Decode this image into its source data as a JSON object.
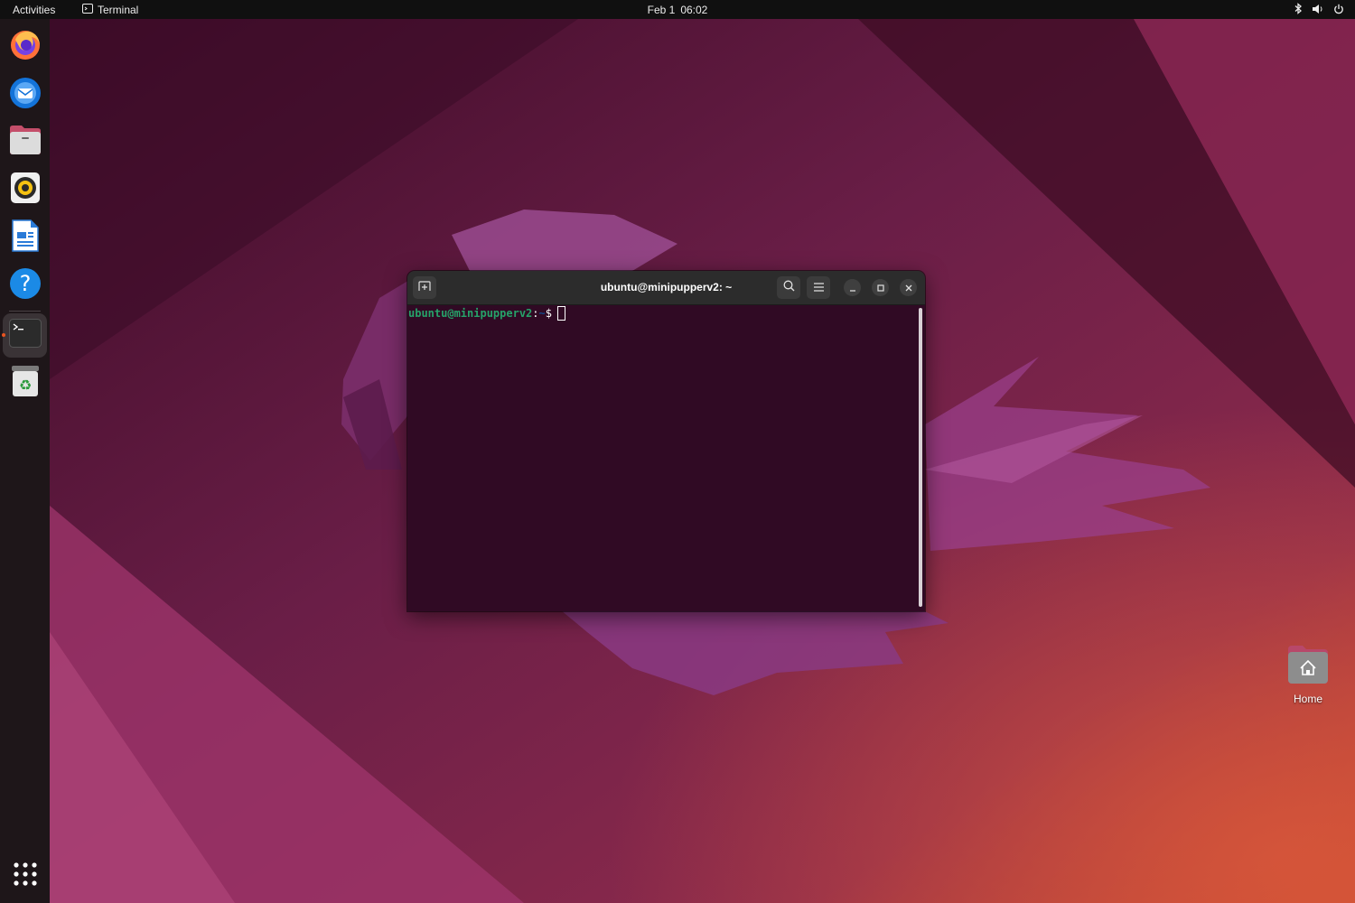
{
  "topbar": {
    "activities": "Activities",
    "app_name": "Terminal",
    "date": "Feb 1",
    "time": "06:02",
    "tray_icons": [
      "bluetooth-icon",
      "volume-icon",
      "power-icon"
    ]
  },
  "dock": {
    "items": [
      {
        "name": "Firefox",
        "icon": "firefox-icon"
      },
      {
        "name": "Thunderbird Mail",
        "icon": "thunderbird-icon"
      },
      {
        "name": "Files",
        "icon": "files-icon"
      },
      {
        "name": "Rhythmbox",
        "icon": "rhythmbox-icon"
      },
      {
        "name": "LibreOffice Writer",
        "icon": "writer-icon"
      },
      {
        "name": "Help",
        "icon": "help-icon"
      },
      {
        "name": "Terminal",
        "icon": "terminal-icon",
        "running": true
      },
      {
        "name": "Trash",
        "icon": "trash-icon"
      }
    ],
    "show_apps_icon": "app-grid-icon"
  },
  "desktop": {
    "home_label": "Home"
  },
  "terminal": {
    "title": "ubuntu@minipupperv2: ~",
    "prompt_user_host": "ubuntu@minipupperv2",
    "prompt_sep": ":",
    "prompt_path": "~",
    "prompt_symbol": "$"
  },
  "colors": {
    "accent": "#e95420",
    "terminal_bg": "#300a24",
    "prompt_user": "#26a269",
    "prompt_path": "#12488b"
  }
}
